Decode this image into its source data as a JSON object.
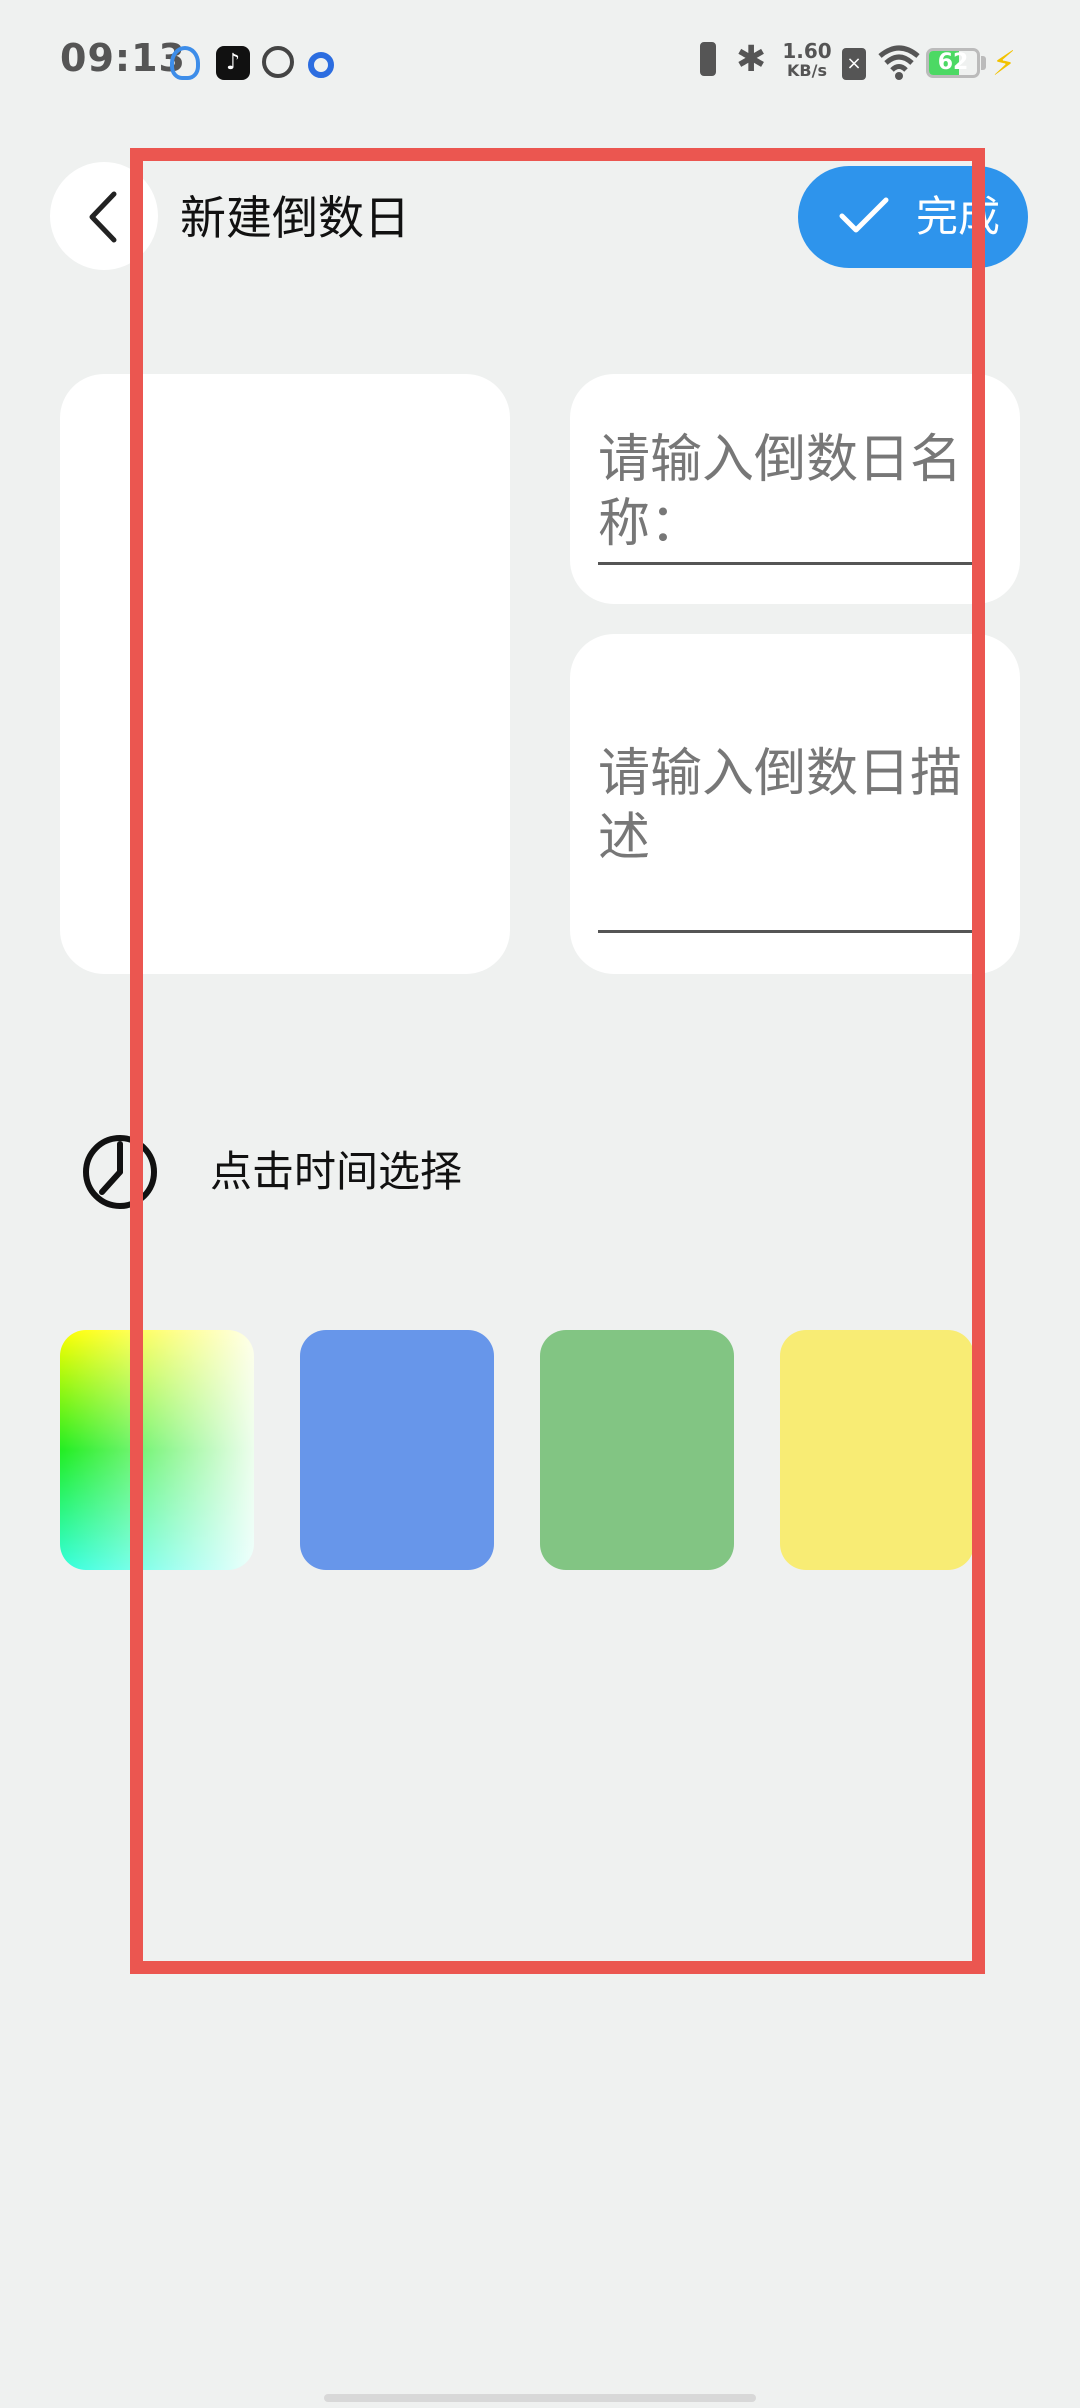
{
  "status_bar": {
    "time": "09:13",
    "net_speed_value": "1.60",
    "net_speed_unit": "KB/s",
    "battery_level": "62",
    "battery_percent": 62,
    "sim_icon": "sim-off-icon",
    "tiktok_glyph": "♪",
    "bluetooth_glyph": "✱",
    "charge_glyph": "⚡"
  },
  "header": {
    "title": "新建倒数日",
    "done_label": "完成"
  },
  "form": {
    "name_placeholder": "请输入倒数日名称：",
    "desc_placeholder": "请输入倒数日描述"
  },
  "time_picker": {
    "label": "点击时间选择"
  },
  "colors": {
    "accent": "#2e94ec",
    "swatches": [
      "gradient",
      "#6796ea",
      "#82c583",
      "#f8ec74"
    ]
  }
}
